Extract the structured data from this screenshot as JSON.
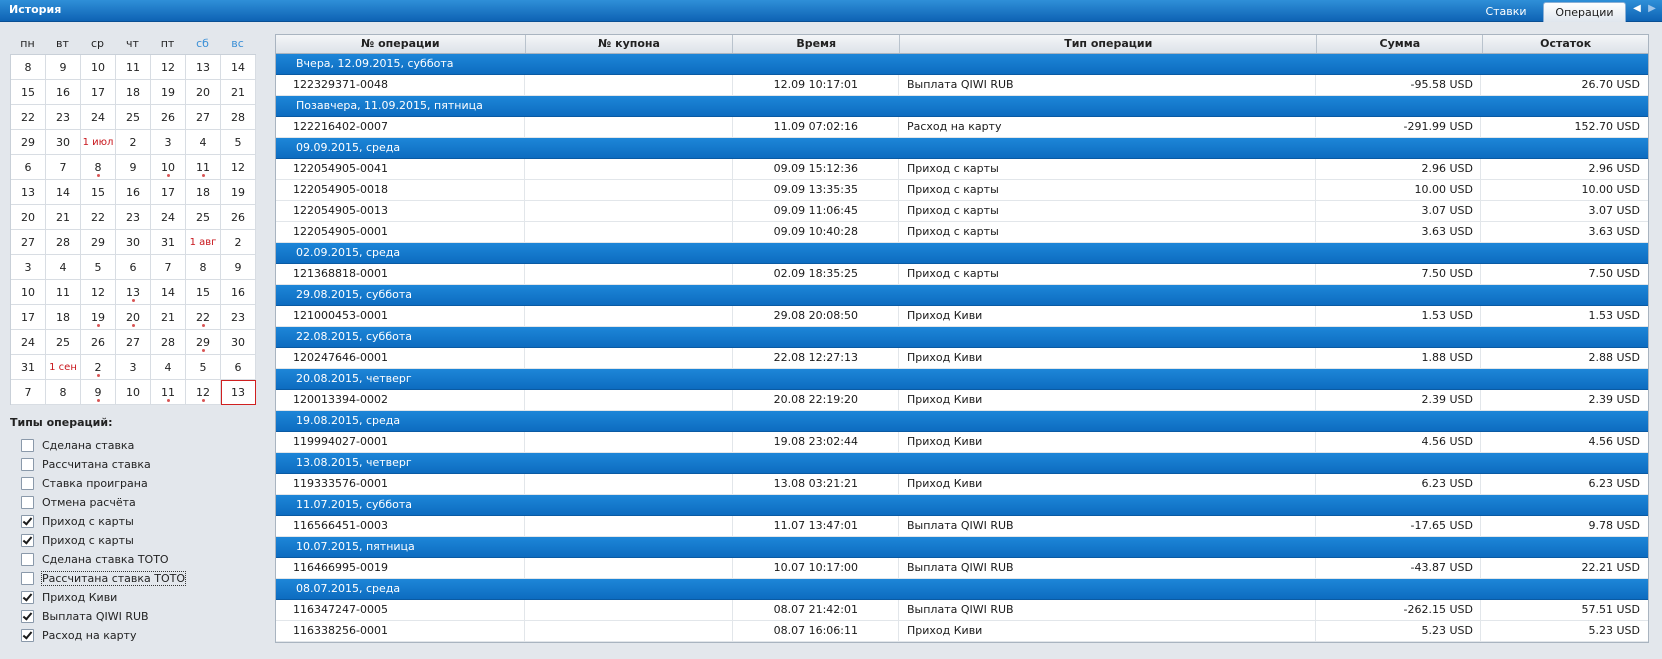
{
  "header": {
    "title": "История",
    "tabs": [
      "Ставки",
      "Операции"
    ],
    "arrow_left": "◀",
    "arrow_right": "▶"
  },
  "calendar": {
    "weekdays": [
      "пн",
      "вт",
      "ср",
      "чт",
      "пт",
      "сб",
      "вс"
    ],
    "weeks": [
      [
        {
          "t": "8"
        },
        {
          "t": "9"
        },
        {
          "t": "10"
        },
        {
          "t": "11"
        },
        {
          "t": "12"
        },
        {
          "t": "13"
        },
        {
          "t": "14"
        }
      ],
      [
        {
          "t": "15"
        },
        {
          "t": "16"
        },
        {
          "t": "17"
        },
        {
          "t": "18"
        },
        {
          "t": "19"
        },
        {
          "t": "20"
        },
        {
          "t": "21"
        }
      ],
      [
        {
          "t": "22"
        },
        {
          "t": "23"
        },
        {
          "t": "24"
        },
        {
          "t": "25"
        },
        {
          "t": "26"
        },
        {
          "t": "27"
        },
        {
          "t": "28"
        }
      ],
      [
        {
          "t": "29"
        },
        {
          "t": "30"
        },
        {
          "t": "1 июл",
          "m": true
        },
        {
          "t": "2"
        },
        {
          "t": "3"
        },
        {
          "t": "4"
        },
        {
          "t": "5"
        }
      ],
      [
        {
          "t": "6"
        },
        {
          "t": "7"
        },
        {
          "t": "8",
          "d": true
        },
        {
          "t": "9"
        },
        {
          "t": "10",
          "d": true
        },
        {
          "t": "11",
          "d": true
        },
        {
          "t": "12"
        }
      ],
      [
        {
          "t": "13"
        },
        {
          "t": "14"
        },
        {
          "t": "15"
        },
        {
          "t": "16"
        },
        {
          "t": "17"
        },
        {
          "t": "18"
        },
        {
          "t": "19"
        }
      ],
      [
        {
          "t": "20"
        },
        {
          "t": "21"
        },
        {
          "t": "22"
        },
        {
          "t": "23"
        },
        {
          "t": "24"
        },
        {
          "t": "25"
        },
        {
          "t": "26"
        }
      ],
      [
        {
          "t": "27"
        },
        {
          "t": "28"
        },
        {
          "t": "29"
        },
        {
          "t": "30"
        },
        {
          "t": "31"
        },
        {
          "t": "1 авг",
          "m": true
        },
        {
          "t": "2"
        }
      ],
      [
        {
          "t": "3"
        },
        {
          "t": "4"
        },
        {
          "t": "5"
        },
        {
          "t": "6"
        },
        {
          "t": "7"
        },
        {
          "t": "8"
        },
        {
          "t": "9"
        }
      ],
      [
        {
          "t": "10"
        },
        {
          "t": "11"
        },
        {
          "t": "12"
        },
        {
          "t": "13",
          "d": true
        },
        {
          "t": "14"
        },
        {
          "t": "15"
        },
        {
          "t": "16"
        }
      ],
      [
        {
          "t": "17"
        },
        {
          "t": "18"
        },
        {
          "t": "19",
          "d": true
        },
        {
          "t": "20",
          "d": true
        },
        {
          "t": "21"
        },
        {
          "t": "22",
          "d": true
        },
        {
          "t": "23"
        }
      ],
      [
        {
          "t": "24"
        },
        {
          "t": "25"
        },
        {
          "t": "26"
        },
        {
          "t": "27"
        },
        {
          "t": "28"
        },
        {
          "t": "29",
          "d": true
        },
        {
          "t": "30"
        }
      ],
      [
        {
          "t": "31"
        },
        {
          "t": "1 сен",
          "m": true
        },
        {
          "t": "2",
          "d": true
        },
        {
          "t": "3"
        },
        {
          "t": "4"
        },
        {
          "t": "5"
        },
        {
          "t": "6"
        }
      ],
      [
        {
          "t": "7"
        },
        {
          "t": "8"
        },
        {
          "t": "9",
          "d": true
        },
        {
          "t": "10"
        },
        {
          "t": "11",
          "d": true
        },
        {
          "t": "12",
          "d": true
        },
        {
          "t": "13",
          "today": true
        }
      ]
    ]
  },
  "filters": {
    "title": "Типы операций:",
    "items": [
      {
        "label": "Сделана ставка",
        "checked": false
      },
      {
        "label": "Рассчитана ставка",
        "checked": false
      },
      {
        "label": "Ставка проиграна",
        "checked": false
      },
      {
        "label": "Отмена расчёта",
        "checked": false
      },
      {
        "label": "Приход с карты",
        "checked": true
      },
      {
        "label": "Приход с карты",
        "checked": true
      },
      {
        "label": "Сделана ставка ТОТО",
        "checked": false
      },
      {
        "label": "Рассчитана ставка ТОТО",
        "checked": false,
        "focus": true
      },
      {
        "label": "Приход Киви",
        "checked": true
      },
      {
        "label": "Выплата QIWI RUB",
        "checked": true
      },
      {
        "label": "Расход на карту",
        "checked": true
      }
    ]
  },
  "table": {
    "columns": [
      "№ операции",
      "№ купона",
      "Время",
      "Тип операции",
      "Сумма",
      "Остаток"
    ],
    "groups": [
      {
        "title": "Вчера, 12.09.2015, суббота",
        "rows": [
          [
            "122329371-0048",
            "",
            "12.09  10:17:01",
            "Выплата QIWI RUB",
            "-95.58 USD",
            "26.70 USD"
          ]
        ]
      },
      {
        "title": "Позавчера, 11.09.2015, пятница",
        "rows": [
          [
            "122216402-0007",
            "",
            "11.09  07:02:16",
            "Расход на карту",
            "-291.99 USD",
            "152.70 USD"
          ]
        ]
      },
      {
        "title": "09.09.2015, среда",
        "rows": [
          [
            "122054905-0041",
            "",
            "09.09  15:12:36",
            "Приход с карты",
            "2.96 USD",
            "2.96 USD"
          ],
          [
            "122054905-0018",
            "",
            "09.09  13:35:35",
            "Приход с карты",
            "10.00 USD",
            "10.00 USD"
          ],
          [
            "122054905-0013",
            "",
            "09.09  11:06:45",
            "Приход с карты",
            "3.07 USD",
            "3.07 USD"
          ],
          [
            "122054905-0001",
            "",
            "09.09  10:40:28",
            "Приход с карты",
            "3.63 USD",
            "3.63 USD"
          ]
        ]
      },
      {
        "title": "02.09.2015, среда",
        "rows": [
          [
            "121368818-0001",
            "",
            "02.09  18:35:25",
            "Приход с карты",
            "7.50 USD",
            "7.50 USD"
          ]
        ]
      },
      {
        "title": "29.08.2015, суббота",
        "rows": [
          [
            "121000453-0001",
            "",
            "29.08  20:08:50",
            "Приход Киви",
            "1.53 USD",
            "1.53 USD"
          ]
        ]
      },
      {
        "title": "22.08.2015, суббота",
        "rows": [
          [
            "120247646-0001",
            "",
            "22.08  12:27:13",
            "Приход Киви",
            "1.88 USD",
            "2.88 USD"
          ]
        ]
      },
      {
        "title": "20.08.2015, четверг",
        "rows": [
          [
            "120013394-0002",
            "",
            "20.08  22:19:20",
            "Приход Киви",
            "2.39 USD",
            "2.39 USD"
          ]
        ]
      },
      {
        "title": "19.08.2015, среда",
        "rows": [
          [
            "119994027-0001",
            "",
            "19.08  23:02:44",
            "Приход Киви",
            "4.56 USD",
            "4.56 USD"
          ]
        ]
      },
      {
        "title": "13.08.2015, четверг",
        "rows": [
          [
            "119333576-0001",
            "",
            "13.08  03:21:21",
            "Приход Киви",
            "6.23 USD",
            "6.23 USD"
          ]
        ]
      },
      {
        "title": "11.07.2015, суббота",
        "rows": [
          [
            "116566451-0003",
            "",
            "11.07  13:47:01",
            "Выплата QIWI RUB",
            "-17.65 USD",
            "9.78 USD"
          ]
        ]
      },
      {
        "title": "10.07.2015, пятница",
        "rows": [
          [
            "116466995-0019",
            "",
            "10.07  10:17:00",
            "Выплата QIWI RUB",
            "-43.87 USD",
            "22.21 USD"
          ]
        ]
      },
      {
        "title": "08.07.2015, среда",
        "rows": [
          [
            "116347247-0005",
            "",
            "08.07  21:42:01",
            "Выплата QIWI RUB",
            "-262.15 USD",
            "57.51 USD"
          ],
          [
            "116338256-0001",
            "",
            "08.07  16:06:11",
            "Приход Киви",
            "5.23 USD",
            "5.23 USD"
          ]
        ]
      }
    ]
  }
}
